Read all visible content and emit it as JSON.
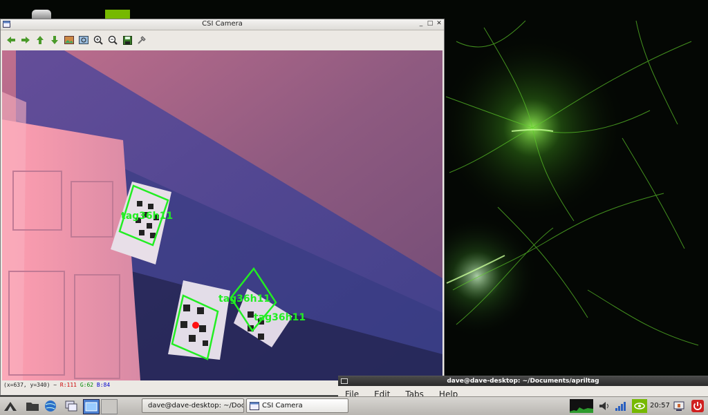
{
  "camera_window": {
    "title": "CSI Camera",
    "win_buttons": {
      "minimize": "_",
      "maximize": "□",
      "close": "✕"
    },
    "toolbar_icons": [
      "arrow-left-icon",
      "arrow-right-icon",
      "arrow-up-icon",
      "arrow-down-icon",
      "image-icon",
      "zoom-fit-icon",
      "zoom-in-icon",
      "zoom-out-icon",
      "save-icon",
      "properties-icon"
    ],
    "tag_labels": [
      "tag36h11",
      "tag36h11",
      "tag36h11"
    ],
    "status": {
      "coords": "(x=637, y=340) ~",
      "r": "R:111",
      "g": "G:62",
      "b": "B:84"
    }
  },
  "terminal_window": {
    "title": "dave@dave-desktop: ~/Documents/apriltag",
    "menu": [
      "File",
      "Edit",
      "Tabs",
      "Help"
    ]
  },
  "taskbar": {
    "tasks": [
      {
        "label": "dave@dave-desktop: ~/Doc...",
        "icon": "terminal-icon"
      },
      {
        "label": "CSI Camera",
        "icon": "window-icon"
      }
    ],
    "clock": "20:57"
  },
  "colors": {
    "tag_outline": "#22ee22",
    "tag_text": "#22ee22",
    "center_dot": "#ff1010",
    "accent": "#76b900"
  }
}
